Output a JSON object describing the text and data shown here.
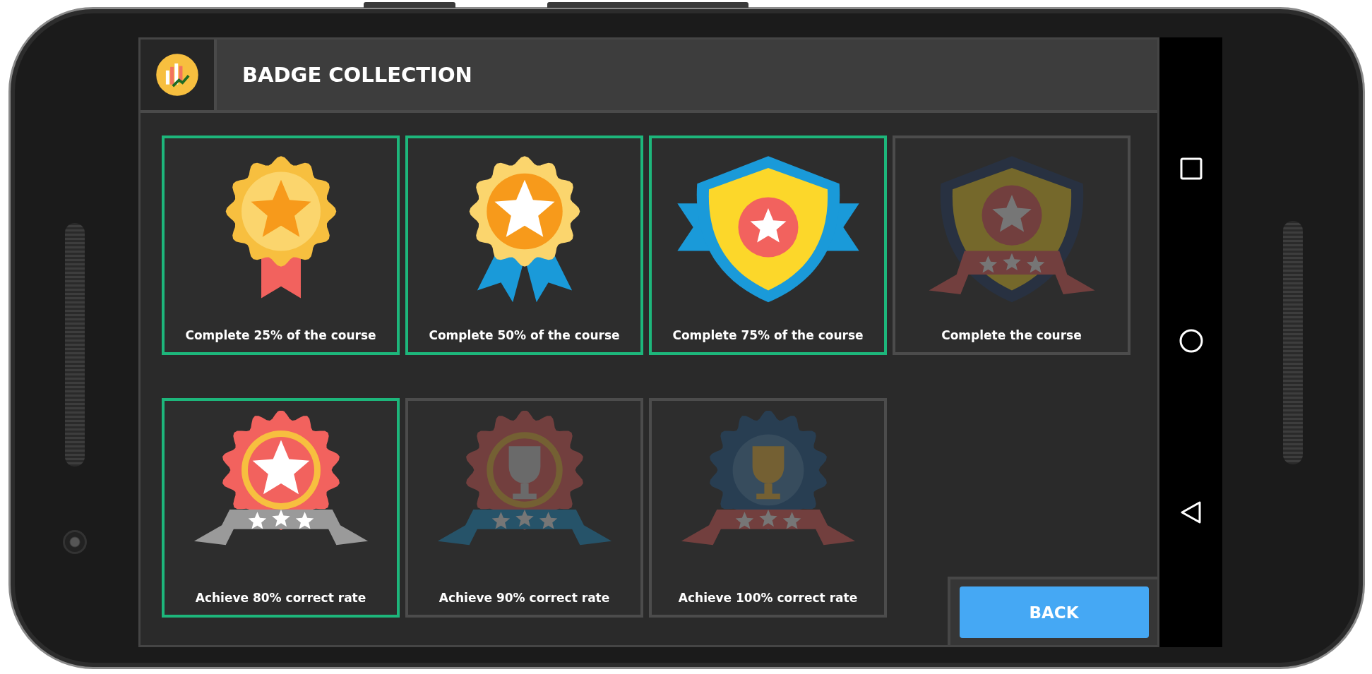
{
  "header": {
    "title": "BADGE COLLECTION"
  },
  "badges": [
    {
      "kind": "medal",
      "label": "Complete 25% of the course",
      "unlocked": true
    },
    {
      "kind": "rosette",
      "label": "Complete 50% of the course",
      "unlocked": true
    },
    {
      "kind": "shield",
      "label": "Complete 75% of the course",
      "unlocked": true
    },
    {
      "kind": "crest",
      "label": "Complete the course",
      "unlocked": false
    },
    {
      "kind": "starburst",
      "label": "Achieve 80% correct rate",
      "unlocked": true
    },
    {
      "kind": "cup",
      "label": "Achieve 90% correct rate",
      "unlocked": false
    },
    {
      "kind": "trophy",
      "label": "Achieve 100% correct rate",
      "unlocked": false
    }
  ],
  "back_button": {
    "label": "BACK"
  }
}
